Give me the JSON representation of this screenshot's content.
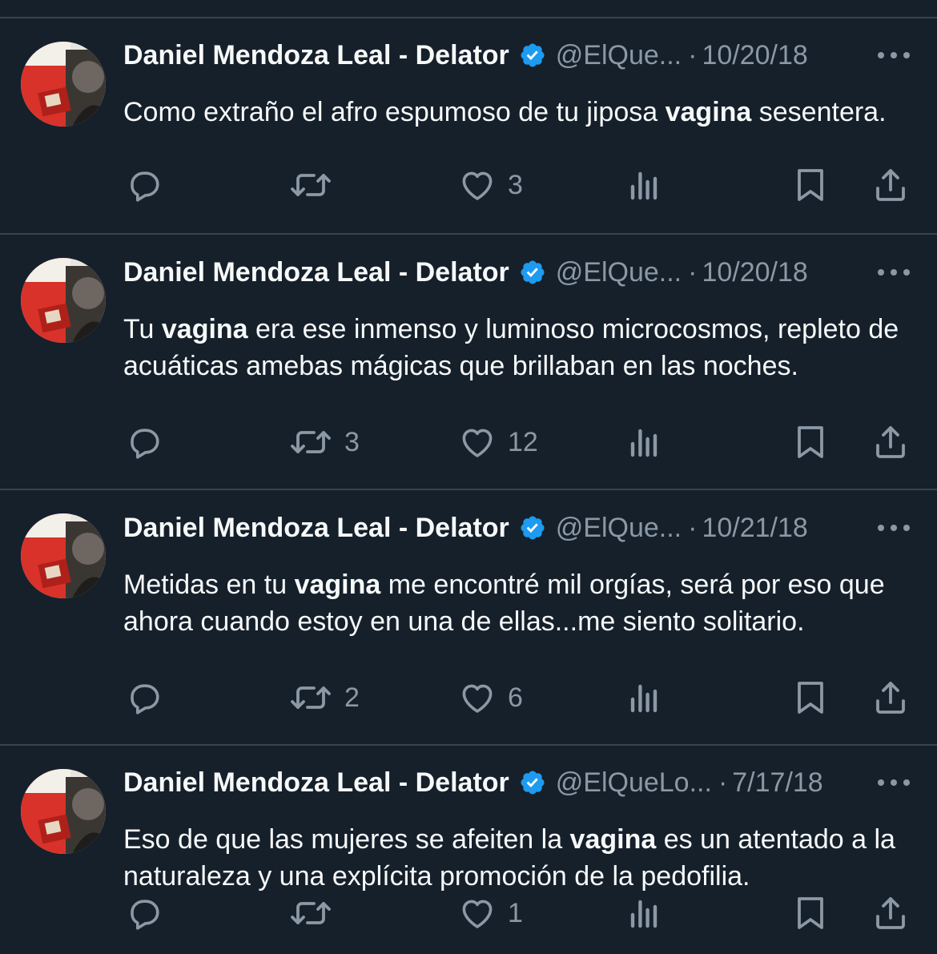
{
  "colors": {
    "background": "#15202b",
    "divider": "#38444d",
    "text_primary": "#f7f9f9",
    "text_secondary": "#8b98a5",
    "verified": "#1d9bf0"
  },
  "tweets": [
    {
      "author_name": "Daniel Mendoza Leal - Delator",
      "handle": "@ElQue...",
      "separator": "·",
      "date": "10/20/18",
      "text_parts": [
        {
          "text": "Como extraño el afro espumoso de tu jiposa ",
          "bold": false
        },
        {
          "text": "vagina",
          "bold": true
        },
        {
          "text": " sesentera.",
          "bold": false
        }
      ],
      "replies": "",
      "retweets": "",
      "likes": "3"
    },
    {
      "author_name": "Daniel Mendoza Leal - Delator",
      "handle": "@ElQue...",
      "separator": "·",
      "date": "10/20/18",
      "text_parts": [
        {
          "text": "Tu ",
          "bold": false
        },
        {
          "text": "vagina",
          "bold": true
        },
        {
          "text": " era ese inmenso y luminoso microcosmos, repleto de acuáticas amebas mágicas que brillaban en las noches.",
          "bold": false
        }
      ],
      "replies": "",
      "retweets": "3",
      "likes": "12"
    },
    {
      "author_name": "Daniel Mendoza Leal - Delator",
      "handle": "@ElQue...",
      "separator": "·",
      "date": "10/21/18",
      "text_parts": [
        {
          "text": "Metidas en tu ",
          "bold": false
        },
        {
          "text": "vagina",
          "bold": true
        },
        {
          "text": " me encontré mil orgías, será por eso que ahora cuando estoy en una de ellas...me siento solitario.",
          "bold": false
        }
      ],
      "replies": "",
      "retweets": "2",
      "likes": "6"
    },
    {
      "author_name": "Daniel Mendoza Leal - Delator",
      "handle": "@ElQueLo...",
      "separator": "·",
      "date": "7/17/18",
      "text_parts": [
        {
          "text": "Eso de que las mujeres se afeiten la ",
          "bold": false
        },
        {
          "text": "vagina",
          "bold": true
        },
        {
          "text": " es un atentado a la naturaleza y una explícita promoción de la pedofilia.",
          "bold": false
        }
      ],
      "replies": "",
      "retweets": "",
      "likes": "1"
    }
  ],
  "icons": {
    "reply": "reply-icon",
    "retweet": "retweet-icon",
    "like": "heart-icon",
    "views": "views-icon",
    "bookmark": "bookmark-icon",
    "share": "share-icon",
    "more": "more-icon",
    "verified": "verified-badge-icon"
  }
}
